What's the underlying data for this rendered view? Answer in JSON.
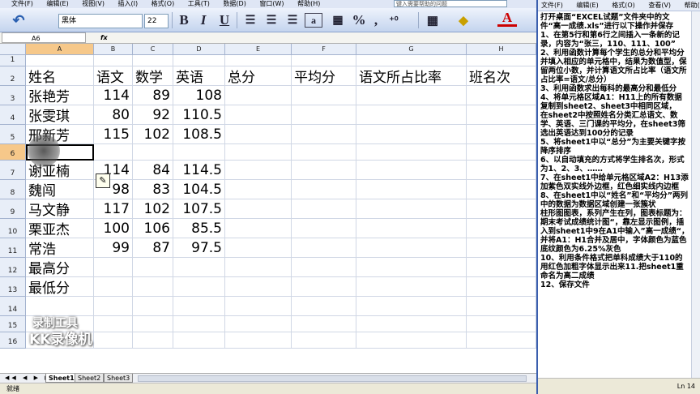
{
  "menubar": {
    "items": [
      "文件(F)",
      "编辑(E)",
      "视图(V)",
      "插入(I)",
      "格式(O)",
      "工具(T)",
      "数据(D)",
      "窗口(W)",
      "帮助(H)"
    ],
    "help_placeholder": "键入需要帮助的问题"
  },
  "toolbar": {
    "font_name": "黑体",
    "font_size": "22",
    "bold": "B",
    "italic": "I",
    "underline": "U",
    "percent": "%",
    "comma": ",",
    "font_color_letter": "A"
  },
  "formulabar": {
    "cell_ref": "A6",
    "fx": "fx"
  },
  "columns": [
    "A",
    "B",
    "C",
    "D",
    "E",
    "F",
    "G",
    "H"
  ],
  "rows": [
    {
      "n": "1",
      "cells": [
        "",
        "",
        "",
        "",
        "",
        "",
        "",
        ""
      ]
    },
    {
      "n": "2",
      "cells": [
        "姓名",
        "语文",
        "数学",
        "英语",
        "总分",
        "平均分",
        "语文所占比率",
        "班名次"
      ]
    },
    {
      "n": "3",
      "cells": [
        "张艳芳",
        "114",
        "89",
        "108",
        "",
        "",
        "",
        ""
      ]
    },
    {
      "n": "4",
      "cells": [
        "张雯琪",
        "80",
        "92",
        "110.5",
        "",
        "",
        "",
        ""
      ]
    },
    {
      "n": "5",
      "cells": [
        "邢新芳",
        "115",
        "102",
        "108.5",
        "",
        "",
        "",
        ""
      ]
    },
    {
      "n": "6",
      "cells": [
        "",
        "",
        "",
        "",
        "",
        "",
        "",
        ""
      ]
    },
    {
      "n": "7",
      "cells": [
        "谢亚楠",
        "114",
        "84",
        "114.5",
        "",
        "",
        "",
        ""
      ]
    },
    {
      "n": "8",
      "cells": [
        "魏闯",
        "98",
        "83",
        "104.5",
        "",
        "",
        "",
        ""
      ]
    },
    {
      "n": "9",
      "cells": [
        "马文静",
        "117",
        "102",
        "107.5",
        "",
        "",
        "",
        ""
      ]
    },
    {
      "n": "10",
      "cells": [
        "栗亚杰",
        "100",
        "106",
        "85.5",
        "",
        "",
        "",
        ""
      ]
    },
    {
      "n": "11",
      "cells": [
        "常浩",
        "99",
        "87",
        "97.5",
        "",
        "",
        "",
        ""
      ]
    },
    {
      "n": "12",
      "cells": [
        "最高分",
        "",
        "",
        "",
        "",
        "",
        "",
        ""
      ]
    },
    {
      "n": "13",
      "cells": [
        "最低分",
        "",
        "",
        "",
        "",
        "",
        "",
        ""
      ]
    },
    {
      "n": "14",
      "cells": [
        "",
        "",
        "",
        "",
        "",
        "",
        "",
        ""
      ]
    },
    {
      "n": "15",
      "cells": [
        "",
        "",
        "",
        "",
        "",
        "",
        "",
        ""
      ]
    },
    {
      "n": "16",
      "cells": [
        "",
        "",
        "",
        "",
        "",
        "",
        "",
        ""
      ]
    }
  ],
  "watermark": {
    "line1": "录制工具",
    "line2": "KK录像机"
  },
  "sheets": [
    "Sheet1",
    "Sheet2",
    "Sheet3"
  ],
  "status": "就绪",
  "notepad": {
    "menu": [
      "文件(F)",
      "编辑(E)",
      "格式(O)",
      "查看(V)",
      "帮助(H)"
    ],
    "text": "打开桌面“EXCEL试题”文件夹中的文件“高一成绩.xls”进行以下操作并保存\n1、在第5行和第6行之间插入一条新的记录，内容为“张三，110、111、100”\n2、利用函数计算每个学生的总分和平均分并填入相应的单元格中，结果为数值型，保留两位小数，并计算语文所占比率（语文所占比率=语文/总分）\n3、利用函数求出每科的最高分和最低分\n4、将单元格区域A1：H11上的所有数据复制到sheet2、sheet3中相同区域，\n在sheet2中按照姓名分类汇总语文、数学、英语、三门课的平均分，在sheet3筛选出英语达到100分的记录\n5、将sheet1中以“总分”为主要关键字按降序排序\n6、以自动填充的方式将学生排名次，形式为1、2、3、……\n7、在sheet1中给单元格区域A2：H13添加紫色双实线外边框，红色细实线内边框\n8、在sheet1中以“姓名”和“平均分”两列中的数据为数据区域创建一张簇状\n柱形图图表，系列产生在列，图表标题为：期末考试成绩统计图“，靠左显示图例，插入到sheet1中9在A1中输入”高一成绩“，并将A1：H1合并及居中，字体颜色为蓝色\n底纹颜色为6.25%灰色\n10、利用条件格式把单科成绩大于110的用红色加粗字体显示出来11.把sheet1重命名为高二成绩\n12、保存文件",
    "status": "Ln 14"
  }
}
